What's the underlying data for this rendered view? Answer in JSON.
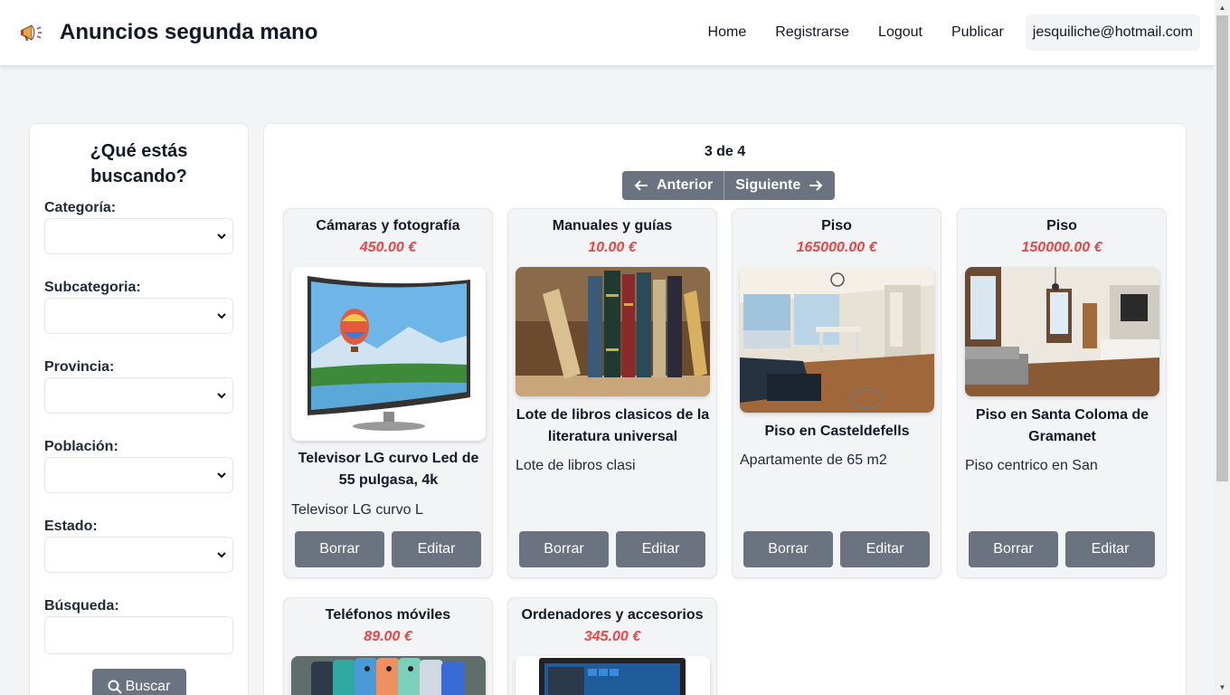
{
  "header": {
    "title": "Anuncios segunda mano",
    "icon": "megaphone-icon",
    "nav": [
      "Home",
      "Registrarse",
      "Logout",
      "Publicar"
    ],
    "user_email": "jesquiliche@hotmail.com"
  },
  "sidebar": {
    "title": "¿Qué estás buscando?",
    "labels": {
      "categoria": "Categoría:",
      "subcategoria": "Subcategoria:",
      "provincia": "Provincia:",
      "poblacion": "Población:",
      "estado": "Estado:",
      "busqueda": "Búsqueda:"
    },
    "search_button": "Buscar"
  },
  "pagination": {
    "count": "3 de 4",
    "prev_label": "Anterior",
    "next_label": "Siguiente"
  },
  "cards": [
    {
      "category": "Cámaras y fotografía",
      "price": "450.00 €",
      "title": "Televisor LG curvo Led de 55 pulgasa, 4k",
      "description": "Televisor LG curvo L",
      "image": "curved-tv-image",
      "delete_label": "Borrar",
      "edit_label": "Editar"
    },
    {
      "category": "Manuales y guías",
      "price": "10.00 €",
      "title": "Lote de libros clasicos de la literatura universal",
      "description": "Lote de libros clasi",
      "image": "books-image",
      "delete_label": "Borrar",
      "edit_label": "Editar"
    },
    {
      "category": "Piso",
      "price": "165000.00 €",
      "title": "Piso en Casteldefells",
      "description": "Apartamente de 65 m2",
      "image": "apartment-livingroom-image",
      "delete_label": "Borrar",
      "edit_label": "Editar"
    },
    {
      "category": "Piso",
      "price": "150000.00 €",
      "title": "Piso en Santa Coloma de Gramanet",
      "description": "Piso centrico en San",
      "image": "apartment-interior-image",
      "delete_label": "Borrar",
      "edit_label": "Editar"
    },
    {
      "category": "Teléfonos móviles",
      "price": "89.00 €",
      "image": "phones-image"
    },
    {
      "category": "Ordenadores y accesorios",
      "price": "345.00 €",
      "image": "laptop-image"
    }
  ],
  "colors": {
    "price": "#ef4444",
    "button": "#6b7280",
    "card_bg": "#f3f4f6"
  }
}
